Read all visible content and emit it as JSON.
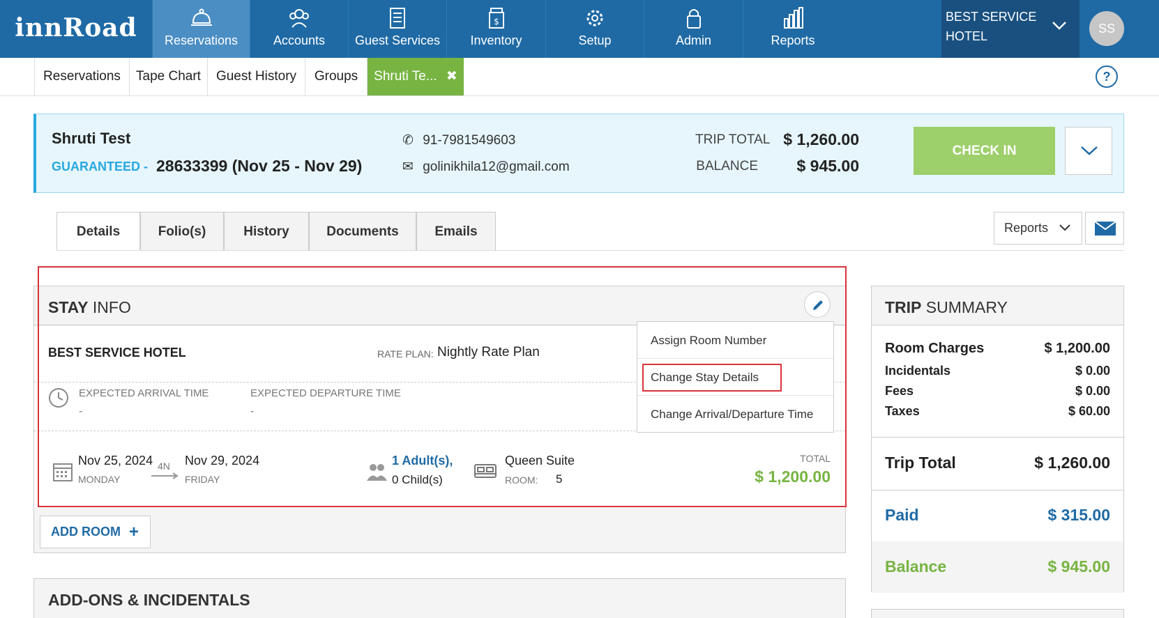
{
  "brand": {
    "logo": "innRoad"
  },
  "nav": [
    {
      "label": "Reservations",
      "icon": "concierge-bell-icon"
    },
    {
      "label": "Accounts",
      "icon": "people-icon"
    },
    {
      "label": "Guest Services",
      "icon": "checklist-icon"
    },
    {
      "label": "Inventory",
      "icon": "inventory-icon"
    },
    {
      "label": "Setup",
      "icon": "gear-icon"
    },
    {
      "label": "Admin",
      "icon": "lock-icon"
    },
    {
      "label": "Reports",
      "icon": "bar-chart-icon"
    }
  ],
  "hotel_selector": {
    "label": "BEST SERVICE HOTEL"
  },
  "user": {
    "initials": "SS"
  },
  "subtabs": [
    "Reservations",
    "Tape Chart",
    "Guest History",
    "Groups",
    "Shruti Te..."
  ],
  "reservation": {
    "guest_name": "Shruti Test",
    "status": "GUARANTEED -",
    "confirmation": "28633399 (Nov 25 - Nov 29)",
    "phone": "91-7981549603",
    "email": "golinikhila12@gmail.com",
    "trip_total_label": "TRIP TOTAL",
    "trip_total": "$ 1,260.00",
    "balance_label": "BALANCE",
    "balance": "$ 945.00",
    "check_in_label": "CHECK IN"
  },
  "detail_tabs": [
    "Details",
    "Folio(s)",
    "History",
    "Documents",
    "Emails"
  ],
  "reports_btn": "Reports",
  "stay_info": {
    "title_bold": "STAY",
    "title_rest": " INFO",
    "hotel": "BEST SERVICE HOTEL",
    "rate_plan_label": "RATE PLAN:",
    "rate_plan": "Nightly Rate Plan",
    "arrival_time_label": "EXPECTED ARRIVAL TIME",
    "arrival_time": "-",
    "departure_time_label": "EXPECTED DEPARTURE TIME",
    "departure_time": "-",
    "arrival_date": "Nov 25, 2024",
    "arrival_day": "MONDAY",
    "nights": "4N",
    "departure_date": "Nov 29, 2024",
    "departure_day": "FRIDAY",
    "adults": "1 Adult(s),",
    "children": "0 Child(s)",
    "room_type": "Queen Suite",
    "room_label": "ROOM:",
    "room_number": "5",
    "total_label": "TOTAL",
    "total": "$ 1,200.00",
    "add_room": "ADD ROOM"
  },
  "edit_menu": [
    "Assign Room Number",
    "Change Stay Details",
    "Change Arrival/Departure Time"
  ],
  "trip_summary": {
    "title_bold": "TRIP",
    "title_rest": " SUMMARY",
    "room_charges_label": "Room Charges",
    "room_charges": "$ 1,200.00",
    "incidentals_label": "Incidentals",
    "incidentals": "$ 0.00",
    "fees_label": "Fees",
    "fees": "$ 0.00",
    "taxes_label": "Taxes",
    "taxes": "$ 60.00",
    "trip_total_label": "Trip Total",
    "trip_total": "$ 1,260.00",
    "paid_label": "Paid",
    "paid": "$ 315.00",
    "balance_label": "Balance",
    "balance": "$ 945.00"
  },
  "addons": {
    "title": "ADD-ONS & INCIDENTALS"
  },
  "colors": {
    "nav_bg": "#1f6aa5",
    "accent_green": "#77b442",
    "accent_blue": "#29a8e0",
    "highlight_red": "#d8333a"
  }
}
